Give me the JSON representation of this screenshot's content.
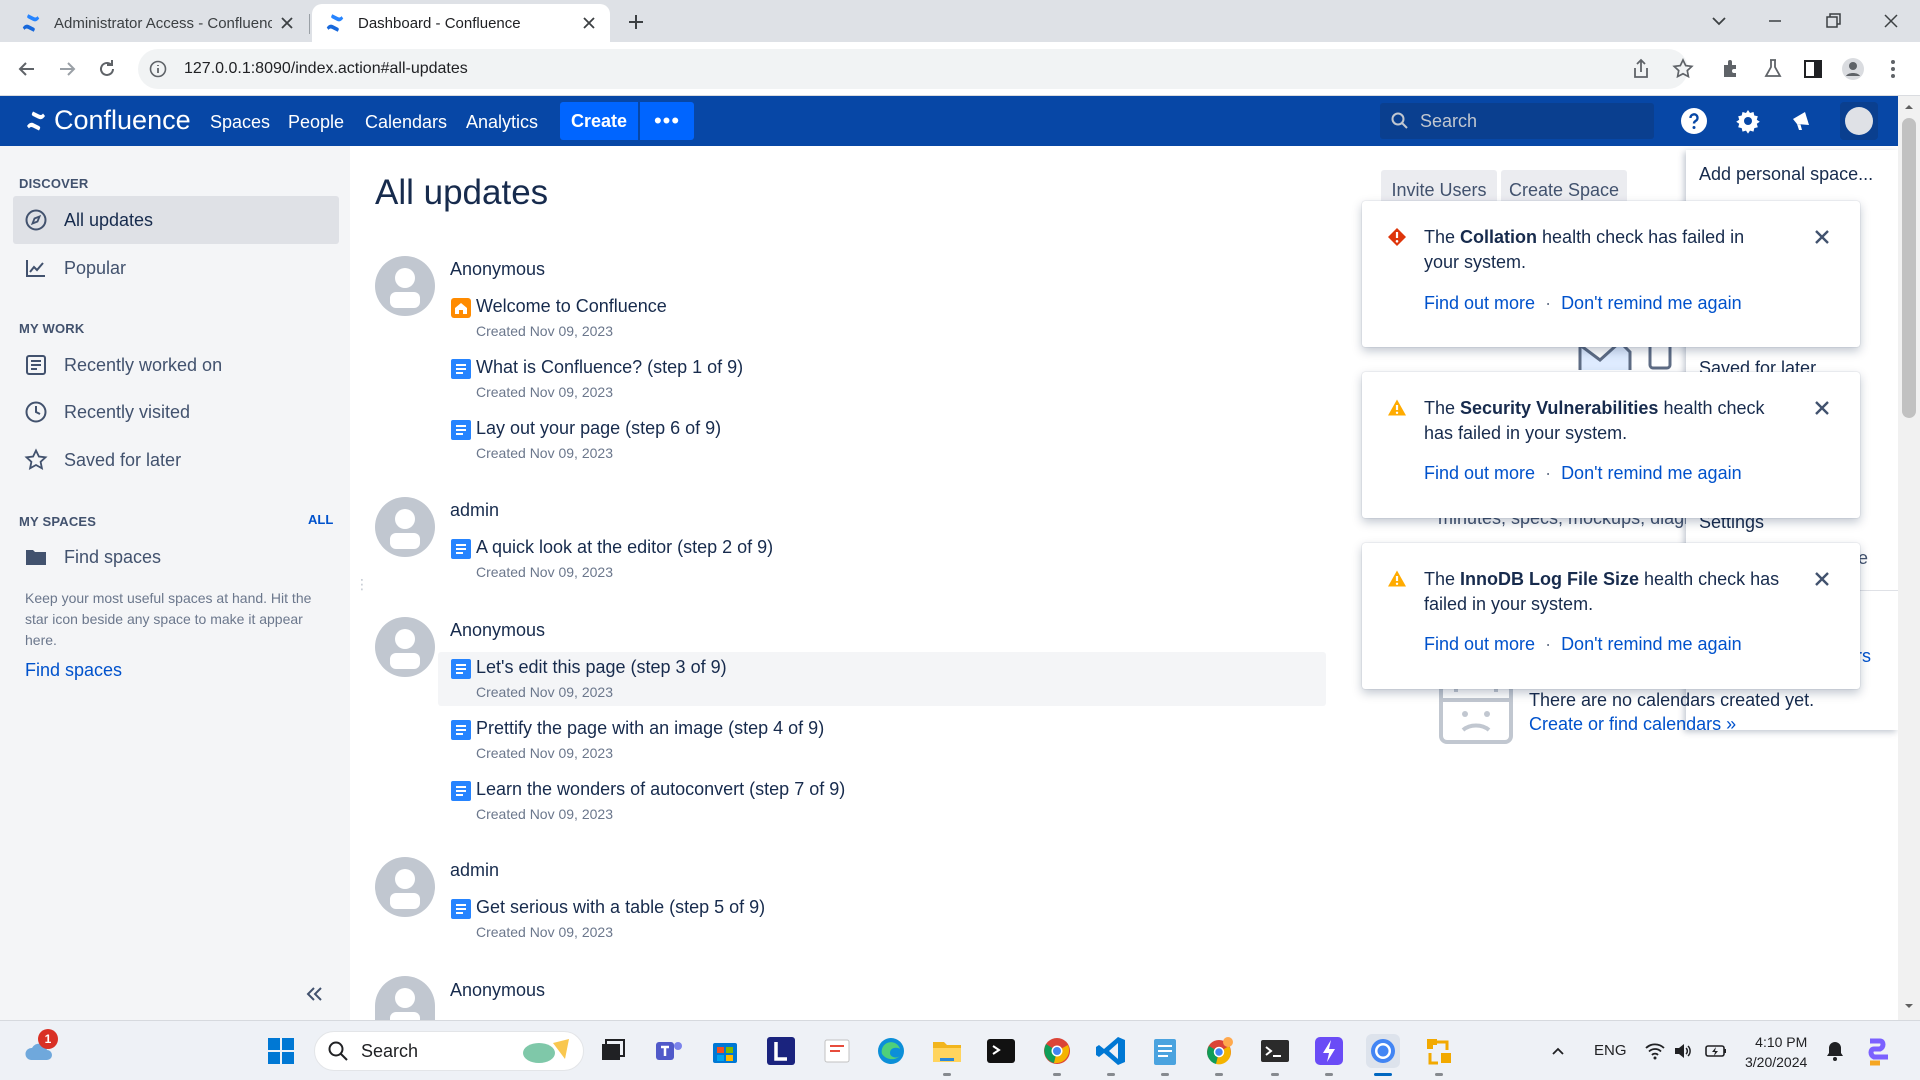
{
  "browser": {
    "tabs": [
      {
        "title": "Administrator Access - Confluence",
        "active": false
      },
      {
        "title": "Dashboard - Confluence",
        "active": true
      }
    ],
    "url": "127.0.0.1:8090/index.action#all-updates"
  },
  "header": {
    "logo": "Confluence",
    "nav": [
      "Spaces",
      "People",
      "Calendars",
      "Analytics"
    ],
    "create_label": "Create",
    "more_label": "•••",
    "search_placeholder": "Search",
    "brand_color": "#0747a6",
    "accent_color": "#0065ff"
  },
  "sidebar": {
    "discover_heading": "DISCOVER",
    "discover": [
      {
        "label": "All updates",
        "icon": "compass-icon",
        "selected": true
      },
      {
        "label": "Popular",
        "icon": "trending-chart-icon",
        "selected": false
      }
    ],
    "mywork_heading": "MY WORK",
    "mywork": [
      {
        "label": "Recently worked on",
        "icon": "document-list-icon"
      },
      {
        "label": "Recently visited",
        "icon": "clock-icon"
      },
      {
        "label": "Saved for later",
        "icon": "star-icon"
      }
    ],
    "myspaces_heading": "MY SPACES",
    "all_link": "ALL",
    "find_spaces_item": "Find spaces",
    "note": "Keep your most useful spaces at hand. Hit the star icon beside any space to make it appear here.",
    "find_spaces_link": "Find spaces"
  },
  "main": {
    "title": "All updates",
    "groups": [
      {
        "author": "Anonymous",
        "items": [
          {
            "title": "Welcome to Confluence",
            "meta": "Created Nov 09, 2023",
            "icon": "home-page-icon"
          },
          {
            "title": "What is Confluence? (step 1 of 9)",
            "meta": "Created Nov 09, 2023",
            "icon": "page-icon"
          },
          {
            "title": "Lay out your page (step 6 of 9)",
            "meta": "Created Nov 09, 2023",
            "icon": "page-icon"
          }
        ]
      },
      {
        "author": "admin",
        "items": [
          {
            "title": "A quick look at the editor (step 2 of 9)",
            "meta": "Created Nov 09, 2023",
            "icon": "page-icon"
          }
        ]
      },
      {
        "author": "Anonymous",
        "items": [
          {
            "title": "Let's edit this page (step 3 of 9)",
            "meta": "Created Nov 09, 2023",
            "icon": "page-icon",
            "hover": true
          },
          {
            "title": "Prettify the page with an image (step 4 of 9)",
            "meta": "Created Nov 09, 2023",
            "icon": "page-icon"
          },
          {
            "title": "Learn the wonders of autoconvert (step 7 of 9)",
            "meta": "Created Nov 09, 2023",
            "icon": "page-icon"
          }
        ]
      },
      {
        "author": "admin",
        "items": [
          {
            "title": "Get serious with a table (step 5 of 9)",
            "meta": "Created Nov 09, 2023",
            "icon": "page-icon"
          }
        ]
      },
      {
        "author": "Anonymous",
        "items": []
      }
    ]
  },
  "right": {
    "invite_users": "Invite Users",
    "create_space": "Create Space",
    "menu": {
      "add_personal_space": "Add personal space...",
      "saved_for_later": "Saved for later",
      "settings": "Settings",
      "fragment_e": "e",
      "fragment_rs": "rs"
    },
    "partial_text": "minutes, specs, mockups, diagra",
    "calendar_empty": "There are no calendars created yet.",
    "calendar_link": "Create or find calendars »"
  },
  "flags": [
    {
      "type": "error",
      "prefix": "The ",
      "bold": "Collation",
      "suffix": " health check has failed in your system.",
      "find_out_more": "Find out more",
      "dot": "·",
      "dont_remind": "Don't remind me again"
    },
    {
      "type": "warning",
      "prefix": "The ",
      "bold": "Security Vulnerabilities",
      "suffix": " health check has failed in your system.",
      "find_out_more": "Find out more",
      "dot": "·",
      "dont_remind": "Don't remind me again"
    },
    {
      "type": "warning",
      "prefix": "The ",
      "bold": "InnoDB Log File Size",
      "suffix": " health check has failed in your system.",
      "find_out_more": "Find out more",
      "dot": "·",
      "dont_remind": "Don't remind me again"
    }
  ],
  "taskbar": {
    "search_placeholder": "Search",
    "weather_badge": "1",
    "language": "ENG",
    "time": "4:10 PM",
    "date": "3/20/2024"
  }
}
